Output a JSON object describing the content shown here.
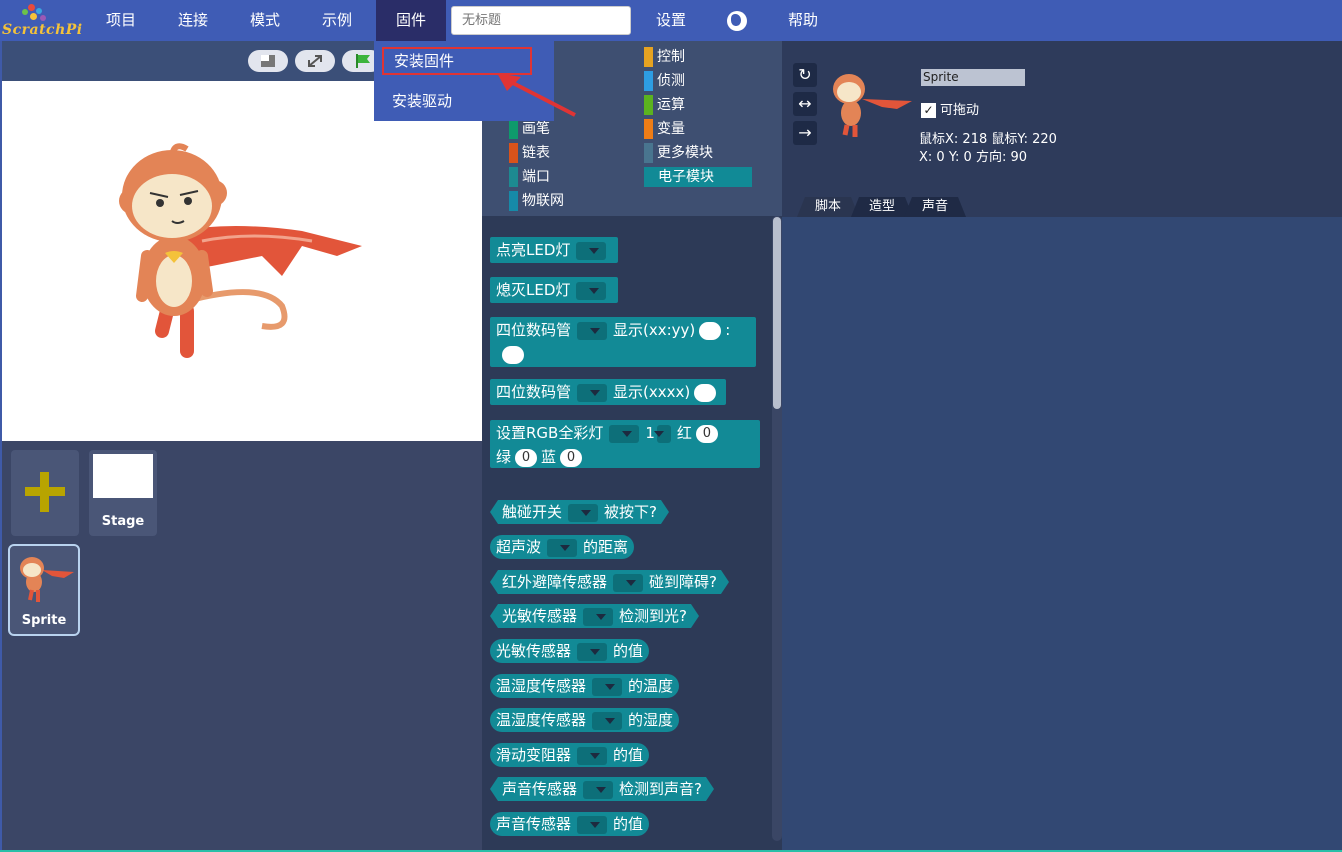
{
  "logo_text": "ScratchPi",
  "menu": {
    "project": "项目",
    "connect": "连接",
    "mode": "模式",
    "examples": "示例",
    "firmware": "固件",
    "title_placeholder": "无标题",
    "settings": "设置",
    "help": "帮助"
  },
  "firmware_menu": {
    "install_firmware": "安装固件",
    "install_driver": "安装驱动"
  },
  "categories": [
    {
      "label": "控制",
      "color": "#e6a321"
    },
    {
      "label": "侦测",
      "color": "#2d9de3"
    },
    {
      "label": "运算",
      "color": "#5bb31f"
    },
    {
      "label": "变量",
      "color": "#ee7d16"
    },
    {
      "label": "更多模块",
      "color": "#49758f"
    },
    {
      "label": "电子模块",
      "color": "#118a96"
    },
    {
      "label": "画笔",
      "color": "#0e9a6c"
    },
    {
      "label": "链表",
      "color": "#d9531b"
    },
    {
      "label": "端口",
      "color": "#1d8a91"
    },
    {
      "label": "物联网",
      "color": "#168aa8"
    }
  ],
  "blocks": {
    "led_on": "点亮LED灯",
    "led_off": "熄灭LED灯",
    "seg4_a": "四位数码管",
    "seg4_a_show": "显示(xx:yy)",
    "seg4_a_colon": ":",
    "seg4_b": "四位数码管",
    "seg4_b_show": "显示(xxxx)",
    "rgb": "设置RGB全彩灯",
    "rgb_index": "1",
    "rgb_red": "红",
    "rgb_red_val": "0",
    "rgb_green": "绿",
    "rgb_green_val": "0",
    "rgb_blue": "蓝",
    "rgb_blue_val": "0",
    "touch": "触碰开关",
    "touch_pressed": "被按下?",
    "ultrasonic": "超声波",
    "ultrasonic_dist": "的距离",
    "ir": "红外避障传感器",
    "ir_obstacle": "碰到障碍?",
    "light1": "光敏传感器",
    "light1_detect": "检测到光?",
    "light2": "光敏传感器",
    "light2_value": "的值",
    "th1": "温湿度传感器",
    "th1_temp": "的温度",
    "th2": "温湿度传感器",
    "th2_hum": "的湿度",
    "slide": "滑动变阻器",
    "slide_value": "的值",
    "sound1": "声音传感器",
    "sound1_detect": "检测到声音?",
    "sound2": "声音传感器",
    "sound2_value": "的值"
  },
  "sprites": {
    "stage_label": "Stage",
    "sprite_label": "Sprite"
  },
  "info": {
    "name": "Sprite",
    "draggable_check": "✓",
    "draggable_label": "可拖动",
    "mouse": "鼠标X: 218    鼠标Y: 220",
    "position": "X: 0    Y: 0    方向: 90"
  },
  "tabs": {
    "scripts": "脚本",
    "costumes": "造型",
    "sounds": "声音"
  }
}
